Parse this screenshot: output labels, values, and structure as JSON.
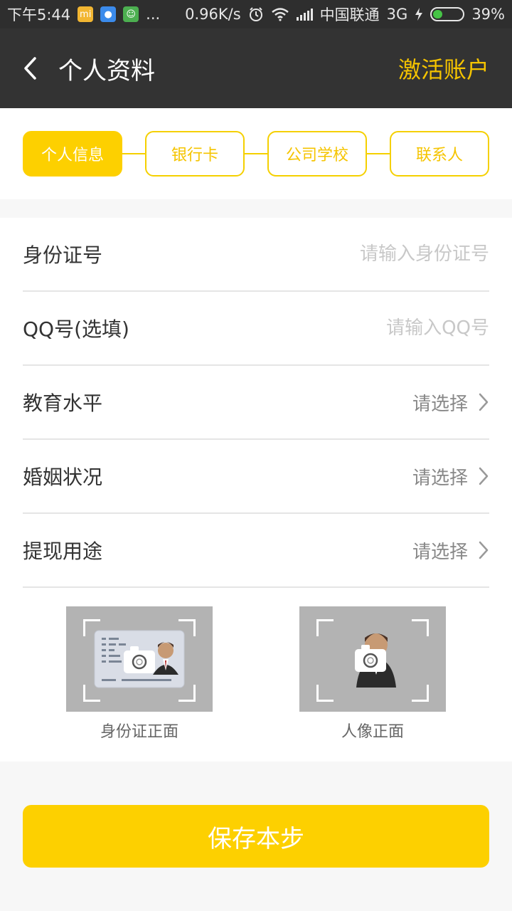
{
  "status_bar": {
    "time": "下午5:44",
    "more": "...",
    "speed": "0.96K/s",
    "carrier": "中国联通",
    "network": "3G",
    "battery": "39%",
    "battery_level": 0.39,
    "icons": [
      "mi-app-icon",
      "chat-app-icon",
      "android-app-icon",
      "alarm-icon",
      "wifi-icon",
      "signal-icon",
      "charging-icon",
      "battery-icon"
    ]
  },
  "nav": {
    "title": "个人资料",
    "action": "激活账户",
    "back_icon": "back-arrow-icon"
  },
  "steps": [
    {
      "label": "个人信息",
      "active": true
    },
    {
      "label": "银行卡",
      "active": false
    },
    {
      "label": "公司学校",
      "active": false
    },
    {
      "label": "联系人",
      "active": false
    }
  ],
  "form": {
    "id_number": {
      "label": "身份证号",
      "placeholder": "请输入身份证号",
      "value": ""
    },
    "qq": {
      "label": "QQ号(选填)",
      "placeholder": "请输入QQ号",
      "value": ""
    },
    "education": {
      "label": "教育水平",
      "value": "请选择"
    },
    "marriage": {
      "label": "婚姻状况",
      "value": "请选择"
    },
    "purpose": {
      "label": "提现用途",
      "value": "请选择"
    }
  },
  "uploads": {
    "id_front": {
      "label": "身份证正面",
      "icon": "camera-icon"
    },
    "portrait": {
      "label": "人像正面",
      "icon": "camera-icon"
    }
  },
  "save_button": "保存本步",
  "colors": {
    "accent": "#fdd000",
    "nav_bg": "#333333",
    "status_bg": "#2e2e2e"
  }
}
